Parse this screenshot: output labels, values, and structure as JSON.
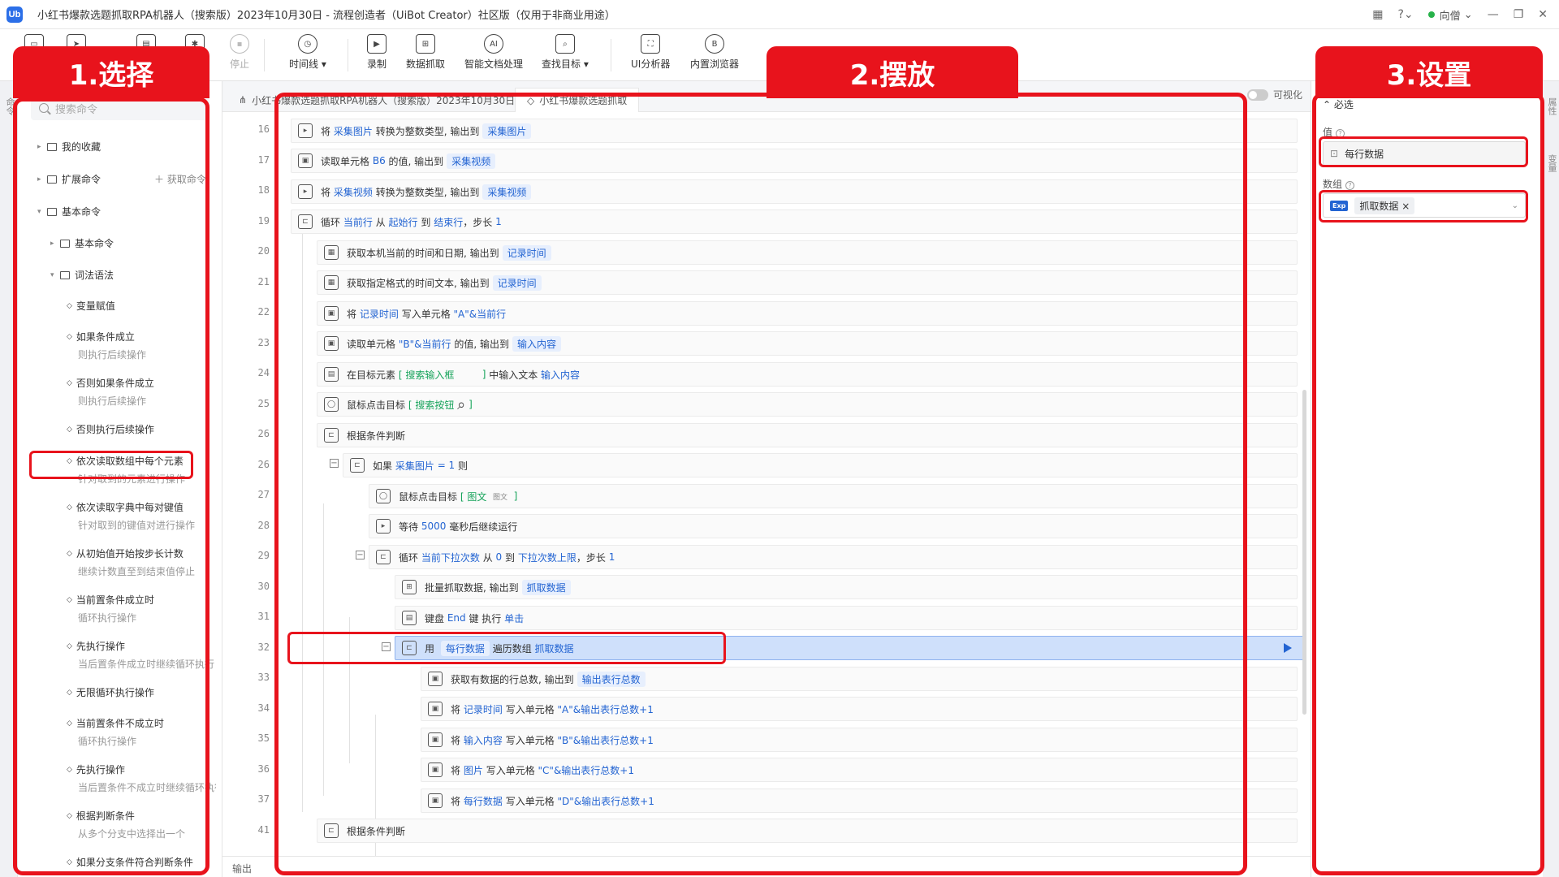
{
  "app": {
    "title": "小红书爆款选题抓取RPA机器人（搜索版）2023年10月30日 - 流程创造者（UiBot Creator）社区版（仅用于非商业用途）",
    "logo_text": "Ub",
    "user": "向僧"
  },
  "toolbar": {
    "stop": "停止",
    "timeline": "时间线",
    "record": "录制",
    "data_scrape": "数据抓取",
    "smart_doc": "智能文档处理",
    "find_target": "查找目标",
    "ui_analyzer": "UI分析器",
    "browser": "内置浏览器"
  },
  "left_panel": {
    "search_placeholder": "搜索命令",
    "favorites": "我的收藏",
    "extensions": "扩展命令",
    "get_command": "获取命令",
    "basic": "基本命令",
    "basic_sub": "基本命令",
    "grammar": "词法语法",
    "items": [
      {
        "label": "变量赋值",
        "sub": ""
      },
      {
        "label": "如果条件成立",
        "sub": "则执行后续操作"
      },
      {
        "label": "否则如果条件成立",
        "sub": "则执行后续操作"
      },
      {
        "label": "否则执行后续操作",
        "sub": ""
      },
      {
        "label": "依次读取数组中每个元素",
        "sub": "针对取到的元素进行操作"
      },
      {
        "label": "依次读取字典中每对键值",
        "sub": "针对取到的键值对进行操作"
      },
      {
        "label": "从初始值开始按步长计数",
        "sub": "继续计数直至到结束值停止"
      },
      {
        "label": "当前置条件成立时",
        "sub": "循环执行操作"
      },
      {
        "label": "先执行操作",
        "sub": "当后置条件成立时继续循环执行"
      },
      {
        "label": "无限循环执行操作",
        "sub": ""
      },
      {
        "label": "当前置条件不成立时",
        "sub": "循环执行操作"
      },
      {
        "label": "先执行操作",
        "sub": "当后置条件不成立时继续循环执行"
      },
      {
        "label": "根据判断条件",
        "sub": "从多个分支中选择出一个"
      },
      {
        "label": "如果分支条件符合判断条件",
        "sub": ""
      }
    ],
    "side_tab": "命令"
  },
  "editor": {
    "tab1": "小红书爆款选题抓取RPA机器人（搜索版）2023年10月30日",
    "tab2": "小红书爆款选题抓取",
    "visual_toggle": "可视化",
    "output_label": "输出",
    "line_numbers": [
      "16",
      "17",
      "18",
      "19",
      "20",
      "21",
      "22",
      "23",
      "24",
      "25",
      "26",
      "26",
      "27",
      "28",
      "29",
      "30",
      "31",
      "32",
      "33",
      "34",
      "35",
      "36",
      "37",
      "41"
    ],
    "lines": {
      "l16": {
        "a": "将",
        "b": "采集图片",
        "c": "转换为整数类型, 输出到",
        "d": "采集图片"
      },
      "l17": {
        "a": "读取单元格",
        "b": "B6",
        "c": "的值, 输出到",
        "d": "采集视频"
      },
      "l18": {
        "a": "将",
        "b": "采集视频",
        "c": "转换为整数类型, 输出到",
        "d": "采集视频"
      },
      "l19": {
        "a": "循环",
        "b": "当前行",
        "c": "从",
        "d": "起始行",
        "e": "到",
        "f": "结束行",
        "g": "，步长",
        "h": "1"
      },
      "l20": {
        "a": "获取本机当前的时间和日期, 输出到",
        "b": "记录时间"
      },
      "l21": {
        "a": "获取指定格式的时间文本, 输出到",
        "b": "记录时间"
      },
      "l22": {
        "a": "将",
        "b": "记录时间",
        "c": "写入单元格",
        "d": "\"A\"&当前行"
      },
      "l23": {
        "a": "读取单元格",
        "b": "\"B\"&当前行",
        "c": "的值, 输出到",
        "d": "输入内容"
      },
      "l24": {
        "a": "在目标元素",
        "b": "[ 搜索输入框",
        "c": "]",
        "d": "中输入文本",
        "e": "输入内容"
      },
      "l25": {
        "a": "鼠标点击目标",
        "b": "[ 搜索按钮",
        "c": "]"
      },
      "l26a": {
        "a": "根据条件判断"
      },
      "l26b": {
        "a": "如果",
        "b": "采集图片",
        "c": "= 1",
        "d": "则"
      },
      "l27": {
        "a": "鼠标点击目标",
        "b": "[ 图文",
        "c": "图文",
        "d": "]"
      },
      "l28": {
        "a": "等待",
        "b": "5000",
        "c": "毫秒后继续运行"
      },
      "l29": {
        "a": "循环",
        "b": "当前下拉次数",
        "c": "从",
        "d": "0",
        "e": "到",
        "f": "下拉次数上限",
        "g": "，步长",
        "h": "1"
      },
      "l30": {
        "a": "批量抓取数据, 输出到",
        "b": "抓取数据"
      },
      "l31": {
        "a": "键盘",
        "b": "End",
        "c": "键 执行",
        "d": "单击"
      },
      "l32": {
        "a": "用",
        "b": "每行数据",
        "c": "遍历数组",
        "d": "抓取数据"
      },
      "l33": {
        "a": "获取有数据的行总数, 输出到",
        "b": "输出表行总数"
      },
      "l34": {
        "a": "将",
        "b": "记录时间",
        "c": "写入单元格",
        "d": "\"A\"&输出表行总数+1"
      },
      "l35": {
        "a": "将",
        "b": "输入内容",
        "c": "写入单元格",
        "d": "\"B\"&输出表行总数+1"
      },
      "l36": {
        "a": "将",
        "b": "图片",
        "c": "写入单元格",
        "d": "\"C\"&输出表行总数+1"
      },
      "l37": {
        "a": "将",
        "b": "每行数据",
        "c": "写入单元格",
        "d": "\"D\"&输出表行总数+1"
      },
      "l41": {
        "a": "根据条件判断"
      }
    }
  },
  "right_panel": {
    "section": "必选",
    "value_label": "值",
    "value": "每行数据",
    "array_label": "数组",
    "exp_badge": "Exp",
    "array_value": "抓取数据",
    "chip_close": "×",
    "side_tab_1": "属性",
    "side_tab_2": "变量"
  },
  "annotations": {
    "step1": "1.选择",
    "step2": "2.摆放",
    "step3": "3.设置",
    "color": "#e8131c"
  }
}
